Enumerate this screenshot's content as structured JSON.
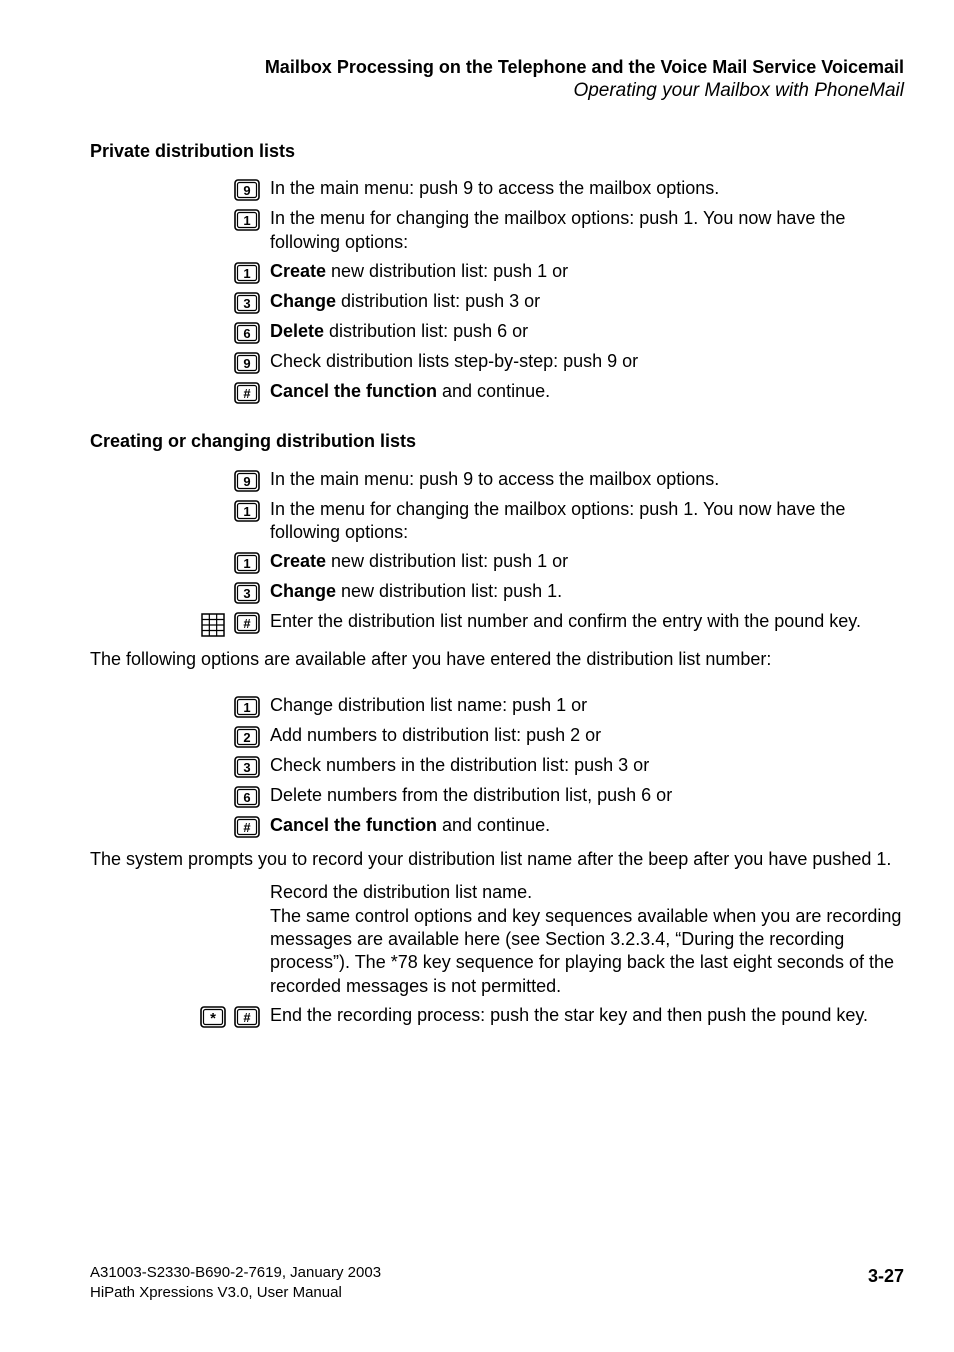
{
  "header": {
    "title": "Mailbox Processing on the Telephone and the Voice Mail Service Voicemail",
    "subtitle": "Operating your Mailbox with PhoneMail"
  },
  "sections": {
    "s1": {
      "title": "Private distribution lists",
      "r1": {
        "key": "9",
        "text": "In the main menu: push 9 to access the mailbox options."
      },
      "r2": {
        "key": "1",
        "text": "In the menu for changing the mailbox options: push 1. You now have the following options:"
      },
      "r3": {
        "key": "1",
        "bold": "Create",
        "rest": " new distribution list: push 1 or"
      },
      "r4": {
        "key": "3",
        "bold": "Change",
        "rest": " distribution list: push 3 or"
      },
      "r5": {
        "key": "6",
        "bold": "Delete",
        "rest": " distribution list: push 6 or"
      },
      "r6": {
        "key": "9",
        "text": "Check distribution lists step-by-step: push 9 or"
      },
      "r7": {
        "key": "#",
        "bold": "Cancel the function",
        "rest": " and continue."
      }
    },
    "s2": {
      "title": "Creating or changing distribution lists",
      "r1": {
        "key": "9",
        "text": "In the main menu: push 9 to access the mailbox options."
      },
      "r2": {
        "key": "1",
        "text": "In the menu for changing the mailbox options: push 1. You now have the following options:"
      },
      "r3": {
        "key": "1",
        "bold": "Create",
        "rest": " new distribution list: push 1 or"
      },
      "r4": {
        "key": "3",
        "bold": "Change",
        "rest": " new distribution list: push 1."
      },
      "r5": {
        "key": "#",
        "text": "Enter the distribution list number and confirm the entry with the pound key."
      },
      "para1": "The following options are available after you have entered the distribution list number:",
      "r6": {
        "key": "1",
        "text": "Change distribution list name: push 1 or"
      },
      "r7": {
        "key": "2",
        "text": "Add numbers to distribution list: push 2 or"
      },
      "r8": {
        "key": "3",
        "text": "Check numbers in the distribution list: push 3 or"
      },
      "r9": {
        "key": "6",
        "text": "Delete numbers from the distribution list, push 6 or"
      },
      "r10": {
        "key": "#",
        "bold": "Cancel the function",
        "rest": " and continue."
      },
      "para2": "The system prompts you to record your distribution list name after the beep after you have pushed 1.",
      "r11": {
        "text": "Record the distribution list name.\nThe same control options and key sequences available when you are recording messages are available here (see Section 3.2.3.4, “During the recording process”). The *78 key sequence for playing back the last eight seconds of the recorded messages is not permitted."
      },
      "r12": {
        "key1": "*",
        "key2": "#",
        "text": "End the recording process: push the star key and then push the pound key."
      }
    }
  },
  "footer": {
    "line1": "A31003-S2330-B690-2-7619, January 2003",
    "line2": "HiPath Xpressions V3.0, User Manual",
    "pageNumber": "3-27"
  }
}
